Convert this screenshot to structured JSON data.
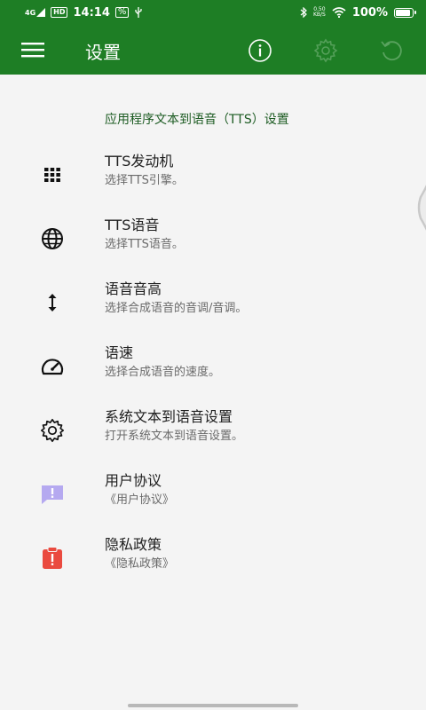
{
  "status_bar": {
    "network": "4G",
    "hd": "HD",
    "time": "14:14",
    "notification": "%",
    "speed_value": "0.50",
    "speed_unit": "KB/S",
    "battery_text": "100%",
    "battery_level": 1.0
  },
  "toolbar": {
    "title": "设置",
    "menu_icon": "hamburger-menu-icon",
    "info_icon": "info-icon",
    "settings_icon": "gear-icon",
    "refresh_icon": "refresh-icon"
  },
  "section": {
    "title": "应用程序文本到语音（TTS）设置"
  },
  "items": [
    {
      "title": "TTS发动机",
      "subtitle": "选择TTS引擎。",
      "icon": "grid-icon"
    },
    {
      "title": "TTS语音",
      "subtitle": "选择TTS语音。",
      "icon": "globe-icon"
    },
    {
      "title": "语音音高",
      "subtitle": "选择合成语音的音调/音调。",
      "icon": "vertical-arrows-icon"
    },
    {
      "title": "语速",
      "subtitle": "选择合成语音的速度。",
      "icon": "speedometer-icon"
    },
    {
      "title": "系统文本到语音设置",
      "subtitle": "打开系统文本到语音设置。",
      "icon": "settings-gear-icon"
    },
    {
      "title": "用户协议",
      "subtitle": "《用户协议》",
      "icon": "feedback-alert-icon"
    },
    {
      "title": "隐私政策",
      "subtitle": "《隐私政策》",
      "icon": "clipboard-alert-icon"
    }
  ],
  "colors": {
    "primary": "#1e7e25",
    "section_title": "#1c5b22",
    "user_agreement_icon": "#b5a9f0",
    "privacy_icon": "#ea4a3f"
  }
}
